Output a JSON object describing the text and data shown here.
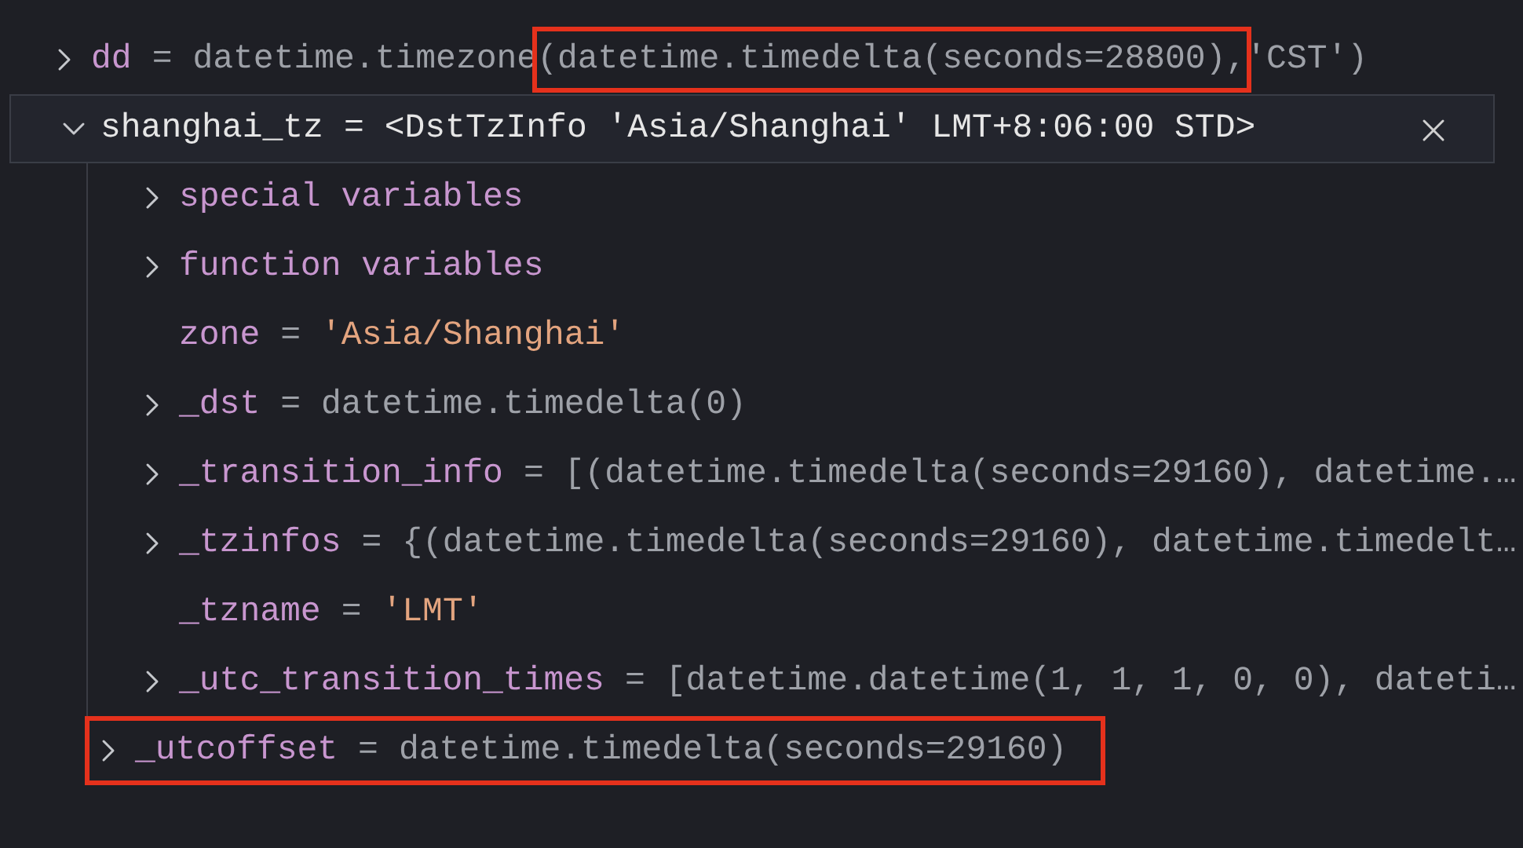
{
  "watch": [
    {
      "name": "dd",
      "separator": "=",
      "expanded": false,
      "selected": false,
      "highlighted": false,
      "kind": "object",
      "value": [
        {
          "text": "datetime.timezone",
          "highlighted": false
        },
        {
          "text": "(datetime.timedelta(seconds=28800), ",
          "highlighted": true
        },
        {
          "text": "'CST')",
          "highlighted": false
        }
      ]
    },
    {
      "name": "shanghai_tz",
      "separator": "=",
      "expanded": true,
      "selected": true,
      "highlighted": false,
      "value": [
        {
          "text": "<DstTzInfo 'Asia/Shanghai' LMT+8:06:00 STD>",
          "highlighted": false
        }
      ],
      "children": [
        {
          "name": "special variables",
          "expanded": false,
          "selected": false,
          "highlighted": false
        },
        {
          "name": "function variables",
          "expanded": false,
          "selected": false,
          "highlighted": false
        },
        {
          "name": "zone",
          "separator": "=",
          "selected": false,
          "highlighted": false,
          "kind": "string",
          "value": [
            {
              "text": "'Asia/Shanghai'",
              "highlighted": false
            }
          ]
        },
        {
          "name": "_dst",
          "separator": "=",
          "expanded": false,
          "selected": false,
          "highlighted": false,
          "kind": "object",
          "value": [
            {
              "text": "datetime.timedelta(0)",
              "highlighted": false
            }
          ]
        },
        {
          "name": "_transition_info",
          "separator": "=",
          "expanded": false,
          "selected": false,
          "highlighted": false,
          "kind": "object",
          "value": [
            {
              "text": "[(datetime.timedelta(seconds=29160), datetime.…",
              "highlighted": false
            }
          ]
        },
        {
          "name": "_tzinfos",
          "separator": "=",
          "expanded": false,
          "selected": false,
          "highlighted": false,
          "kind": "object",
          "value": [
            {
              "text": "{(datetime.timedelta(seconds=29160), datetime.timedelt…",
              "highlighted": false
            }
          ]
        },
        {
          "name": "_tzname",
          "separator": "=",
          "selected": false,
          "highlighted": false,
          "kind": "string",
          "value": [
            {
              "text": "'LMT'",
              "highlighted": false
            }
          ]
        },
        {
          "name": "_utc_transition_times",
          "separator": "=",
          "expanded": false,
          "selected": false,
          "highlighted": false,
          "kind": "object",
          "value": [
            {
              "text": "[datetime.datetime(1, 1, 1, 0, 0), dateti…",
              "highlighted": false
            }
          ]
        },
        {
          "name": "_utcoffset",
          "separator": "=",
          "expanded": false,
          "selected": false,
          "highlighted": true,
          "kind": "object",
          "value": [
            {
              "text": "datetime.timedelta(seconds=29160)",
              "highlighted": false
            }
          ]
        }
      ]
    }
  ]
}
